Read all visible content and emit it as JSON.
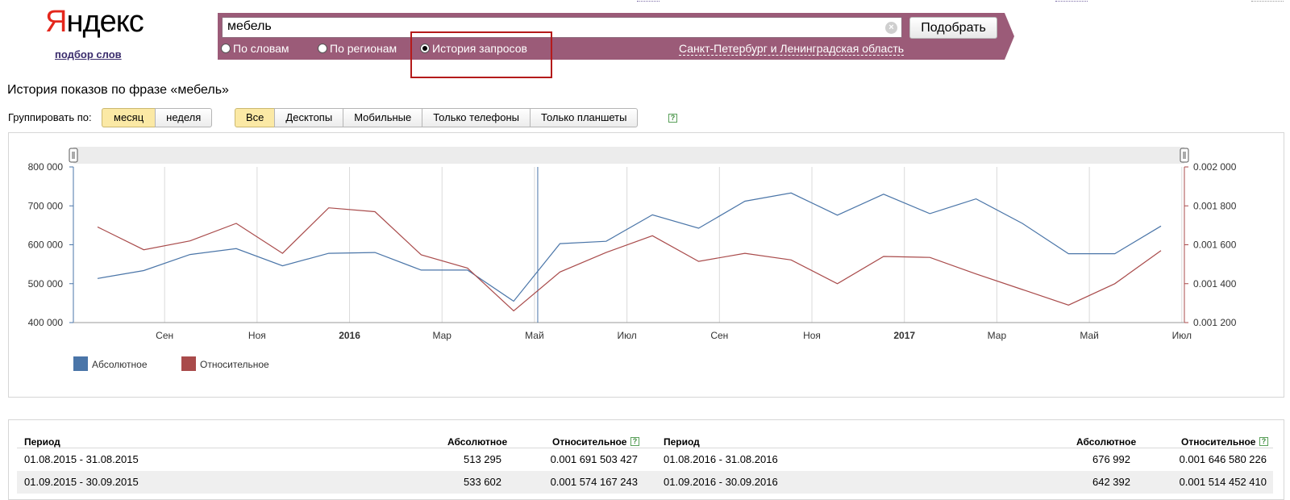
{
  "header": {
    "logo_first": "Я",
    "logo_rest": "ндекс",
    "logo_subtitle": "подбор слов"
  },
  "search": {
    "query": "мебель",
    "submit_label": "Подобрать",
    "modes": [
      "По словам",
      "По регионам",
      "История запросов"
    ],
    "selected_mode": "История запросов",
    "region": "Санкт-Петербург и Ленинградская область"
  },
  "page": {
    "title": "История показов по фразе «мебель»",
    "group_label": "Группировать по:",
    "group_options": [
      "месяц",
      "неделя"
    ],
    "group_selected": "месяц",
    "device_options": [
      "Все",
      "Десктопы",
      "Мобильные",
      "Только телефоны",
      "Только планшеты"
    ],
    "device_selected": "Все",
    "help_glyph": "?"
  },
  "chart_data": {
    "type": "line",
    "x": [
      "2015-08",
      "2015-09",
      "2015-10",
      "2015-11",
      "2015-12",
      "2016-01",
      "2016-02",
      "2016-03",
      "2016-04",
      "2016-05",
      "2016-06",
      "2016-07",
      "2016-08",
      "2016-09",
      "2016-10",
      "2016-11",
      "2016-12",
      "2017-01",
      "2017-02",
      "2017-03",
      "2017-04",
      "2017-05",
      "2017-06",
      "2017-07"
    ],
    "x_tick_labels": [
      "Сен",
      "Ноя",
      "2016",
      "Мар",
      "Май",
      "Июл",
      "Сен",
      "Ноя",
      "2017",
      "Мар",
      "Май",
      "Июл"
    ],
    "series": [
      {
        "name": "Абсолютное",
        "axis": "left",
        "color": "#4a75a8",
        "values": [
          513295,
          533602,
          575000,
          590000,
          546000,
          578000,
          580000,
          535000,
          535000,
          455000,
          603000,
          609000,
          676992,
          642392,
          712000,
          733000,
          676000,
          730000,
          680000,
          718000,
          655000,
          577000,
          577000,
          648000
        ]
      },
      {
        "name": "Относительное",
        "axis": "right",
        "color": "#a94b4b",
        "values": [
          0.001691503427,
          0.001574167243,
          0.00162,
          0.00171,
          0.001556,
          0.00179,
          0.00177,
          0.001548,
          0.00148,
          0.00126,
          0.00146,
          0.00156,
          0.001646580226,
          0.00151445241,
          0.001556,
          0.001522,
          0.0014,
          0.00154,
          0.001535,
          0.00145,
          0.00137,
          0.00129,
          0.0014,
          0.00157
        ]
      }
    ],
    "y_left": {
      "min": 400000,
      "max": 800000,
      "ticks": [
        "400 000",
        "500 000",
        "600 000",
        "700 000",
        "800 000"
      ]
    },
    "y_right": {
      "min": 0.0012,
      "max": 0.002,
      "ticks": [
        "0.001 200",
        "0.001 400",
        "0.001 600",
        "0.001 800",
        "0.002 000"
      ]
    },
    "legend_position": "bottom-left",
    "grid": true
  },
  "table": {
    "columns": [
      "Период",
      "Абсолютное",
      "Относительное"
    ],
    "left_rows": [
      {
        "period": "01.08.2015 - 31.08.2015",
        "abs": "513 295",
        "rel": "0.001 691 503 427"
      },
      {
        "period": "01.09.2015 - 30.09.2015",
        "abs": "533 602",
        "rel": "0.001 574 167 243"
      }
    ],
    "right_rows": [
      {
        "period": "01.08.2016 - 31.08.2016",
        "abs": "676 992",
        "rel": "0.001 646 580 226"
      },
      {
        "period": "01.09.2016 - 30.09.2016",
        "abs": "642 392",
        "rel": "0.001 514 452 410"
      }
    ]
  },
  "colors": {
    "search_bar": "#9b5b78",
    "highlight": "#b41b1b",
    "active_toggle": "#fbe9a5"
  }
}
